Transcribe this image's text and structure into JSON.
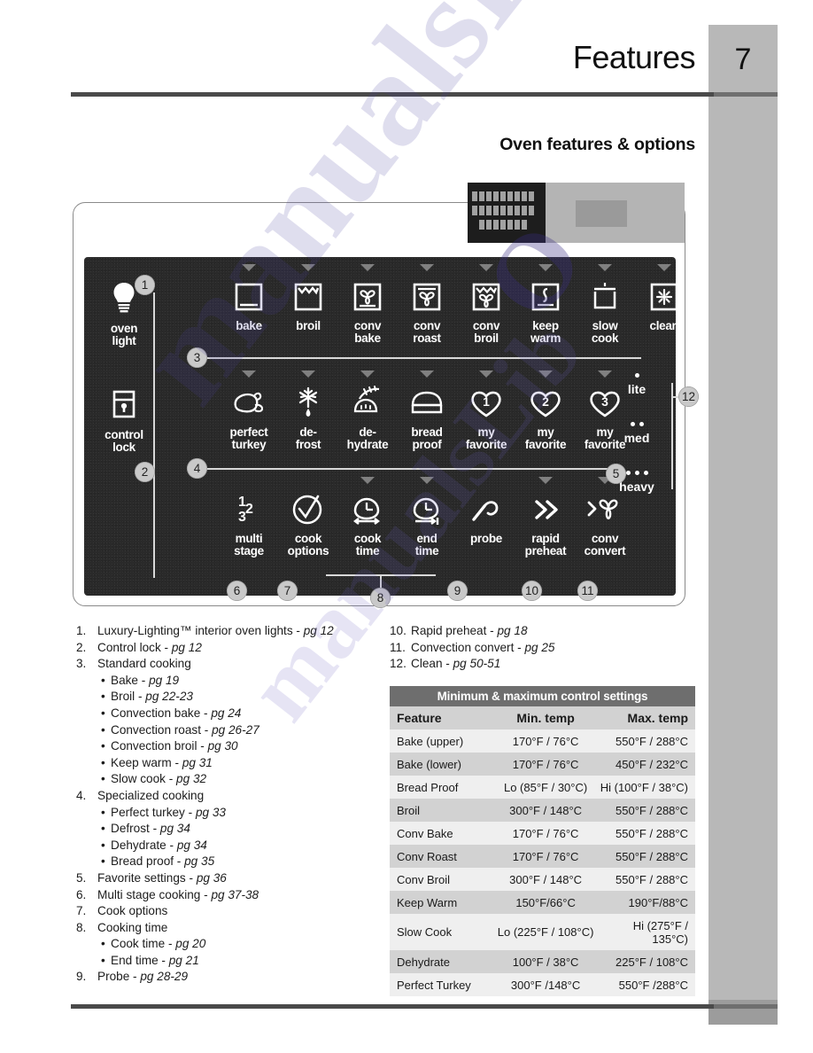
{
  "header": {
    "title": "Features",
    "page_number": "7",
    "section_title": "Oven features & options"
  },
  "control_panel": {
    "row1": [
      {
        "label_line1": "bake",
        "label_line2": "",
        "icon": "oven-box-icon"
      },
      {
        "label_line1": "broil",
        "label_line2": "",
        "icon": "broil-element-icon"
      },
      {
        "label_line1": "conv",
        "label_line2": "bake",
        "icon": "convection-fan-box-icon"
      },
      {
        "label_line1": "conv",
        "label_line2": "roast",
        "icon": "convection-roast-icon"
      },
      {
        "label_line1": "conv",
        "label_line2": "broil",
        "icon": "convection-broil-icon"
      },
      {
        "label_line1": "keep",
        "label_line2": "warm",
        "icon": "keep-warm-icon"
      },
      {
        "label_line1": "slow",
        "label_line2": "cook",
        "icon": "slow-cook-pot-icon"
      },
      {
        "label_line1": "clean",
        "label_line2": "",
        "icon": "clean-sparkle-icon"
      }
    ],
    "row2": [
      {
        "label_line1": "perfect",
        "label_line2": "turkey",
        "icon": "turkey-icon"
      },
      {
        "label_line1": "de-",
        "label_line2": "frost",
        "icon": "snowflake-drop-icon"
      },
      {
        "label_line1": "de-",
        "label_line2": "hydrate",
        "icon": "dehydrate-icon"
      },
      {
        "label_line1": "bread",
        "label_line2": "proof",
        "icon": "bread-loaf-icon"
      },
      {
        "label_line1": "my",
        "label_line2": "favorite",
        "icon": "heart-1-icon"
      },
      {
        "label_line1": "my",
        "label_line2": "favorite",
        "icon": "heart-2-icon"
      },
      {
        "label_line1": "my",
        "label_line2": "favorite",
        "icon": "heart-3-icon"
      }
    ],
    "row3": [
      {
        "label_line1": "multi",
        "label_line2": "stage",
        "icon": "multi-stage-123-icon"
      },
      {
        "label_line1": "cook",
        "label_line2": "options",
        "icon": "check-circle-icon"
      },
      {
        "label_line1": "cook",
        "label_line2": "time",
        "icon": "cook-time-clock-icon"
      },
      {
        "label_line1": "end",
        "label_line2": "time",
        "icon": "end-time-clock-icon"
      },
      {
        "label_line1": "probe",
        "label_line2": "",
        "icon": "meat-probe-icon"
      },
      {
        "label_line1": "rapid",
        "label_line2": "preheat",
        "icon": "double-chevron-icon"
      },
      {
        "label_line1": "conv",
        "label_line2": "convert",
        "icon": "convection-convert-icon"
      }
    ],
    "left_keys": [
      {
        "label_line1": "oven",
        "label_line2": "light",
        "icon": "light-bulb-icon"
      },
      {
        "label_line1": "control",
        "label_line2": "lock",
        "icon": "lock-icon"
      }
    ],
    "clean_levels": [
      {
        "label": "lite",
        "dots": 1
      },
      {
        "label": "med",
        "dots": 2
      },
      {
        "label": "heavy",
        "dots": 3
      }
    ],
    "callouts": [
      "1",
      "2",
      "3",
      "4",
      "5",
      "6",
      "7",
      "8",
      "9",
      "10",
      "11",
      "12"
    ]
  },
  "legend_left": [
    {
      "num": "1.",
      "text": "Luxury-Lighting™ interior oven lights -",
      "pg": "pg 12",
      "sub": false
    },
    {
      "num": "2.",
      "text": "Control lock -",
      "pg": "pg 12",
      "sub": false
    },
    {
      "num": "3.",
      "text": "Standard cooking",
      "pg": "",
      "sub": false
    },
    {
      "num": "",
      "text": "Bake -",
      "pg": "pg 19",
      "sub": true
    },
    {
      "num": "",
      "text": "Broil -",
      "pg": "pg 22-23",
      "sub": true
    },
    {
      "num": "",
      "text": "Convection bake -",
      "pg": "pg 24",
      "sub": true
    },
    {
      "num": "",
      "text": "Convection roast -",
      "pg": "pg 26-27",
      "sub": true
    },
    {
      "num": "",
      "text": "Convection broil -",
      "pg": "pg 30",
      "sub": true
    },
    {
      "num": "",
      "text": "Keep warm -",
      "pg": "pg 31",
      "sub": true
    },
    {
      "num": "",
      "text": "Slow cook -",
      "pg": "pg 32",
      "sub": true
    },
    {
      "num": "4.",
      "text": "Specialized cooking",
      "pg": "",
      "sub": false
    },
    {
      "num": "",
      "text": "Perfect turkey -",
      "pg": "pg 33",
      "sub": true
    },
    {
      "num": "",
      "text": "Defrost -",
      "pg": "pg 34",
      "sub": true
    },
    {
      "num": "",
      "text": "Dehydrate -",
      "pg": "pg 34",
      "sub": true
    },
    {
      "num": "",
      "text": "Bread proof -",
      "pg": "pg 35",
      "sub": true
    },
    {
      "num": "5.",
      "text": "Favorite settings -",
      "pg": "pg 36",
      "sub": false
    },
    {
      "num": "6.",
      "text": "Multi stage cooking -",
      "pg": "pg 37-38",
      "sub": false
    },
    {
      "num": "7.",
      "text": "Cook options",
      "pg": "",
      "sub": false
    },
    {
      "num": "8.",
      "text": "Cooking time",
      "pg": "",
      "sub": false
    },
    {
      "num": "",
      "text": "Cook time -",
      "pg": "pg 20",
      "sub": true
    },
    {
      "num": "",
      "text": "End time -",
      "pg": "pg 21",
      "sub": true
    },
    {
      "num": "9.",
      "text": "Probe -",
      "pg": "pg 28-29",
      "sub": false
    }
  ],
  "legend_right": [
    {
      "num": "10.",
      "text": "Rapid preheat -",
      "pg": "pg 18"
    },
    {
      "num": "11.",
      "text": "Convection convert -",
      "pg": "pg 25"
    },
    {
      "num": "12.",
      "text": "Clean -",
      "pg": "pg 50-51"
    }
  ],
  "table": {
    "caption": "Minimum & maximum control settings",
    "headers": [
      "Feature",
      "Min. temp",
      "Max. temp"
    ],
    "rows": [
      [
        "Bake (upper)",
        "170°F / 76°C",
        "550°F / 288°C"
      ],
      [
        "Bake (lower)",
        "170°F / 76°C",
        "450°F / 232°C"
      ],
      [
        "Bread Proof",
        "Lo (85°F / 30°C)",
        "Hi (100°F / 38°C)"
      ],
      [
        "Broil",
        "300°F / 148°C",
        "550°F / 288°C"
      ],
      [
        "Conv Bake",
        "170°F / 76°C",
        "550°F / 288°C"
      ],
      [
        "Conv Roast",
        "170°F / 76°C",
        "550°F / 288°C"
      ],
      [
        "Conv Broil",
        "300°F / 148°C",
        "550°F / 288°C"
      ],
      [
        "Keep Warm",
        "150°F/66°C",
        "190°F/88°C"
      ],
      [
        "Slow Cook",
        "Lo (225°F / 108°C)",
        "Hi (275°F / 135°C)"
      ],
      [
        "Dehydrate",
        "100°F / 38°C",
        "225°F / 108°C"
      ],
      [
        "Perfect Turkey",
        "300°F /148°C",
        "550°F /288°C"
      ]
    ]
  },
  "watermark": {
    "text": "manualsLib",
    "text2": "O",
    "color": "#4a3f9e"
  }
}
